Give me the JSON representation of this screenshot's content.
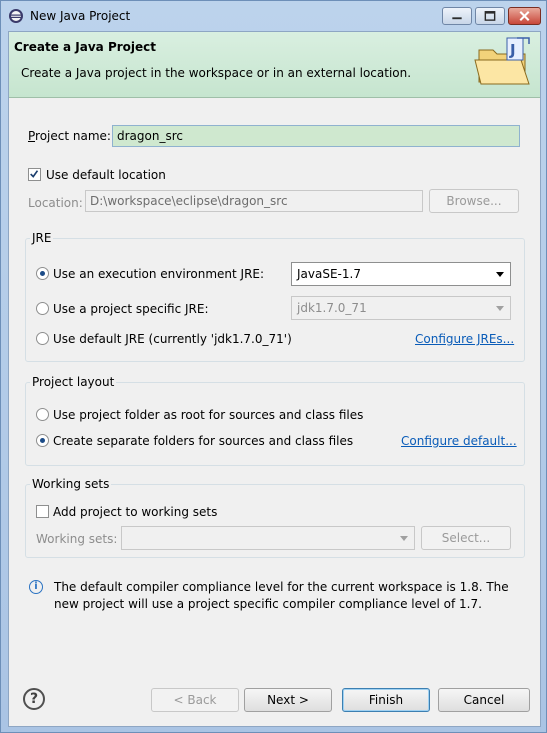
{
  "window": {
    "title": "New Java Project",
    "icon": "eclipse-icon"
  },
  "banner": {
    "title": "Create a Java Project",
    "description": "Create a Java project in the workspace or in an external location.",
    "image": "new-java-project-wizard-icon"
  },
  "project_name": {
    "label": "Project name:",
    "value": "dragon_src"
  },
  "default_location": {
    "label": "Use default location",
    "checked": true
  },
  "location": {
    "label": "Location:",
    "value": "D:\\workspace\\eclipse\\dragon_src",
    "browse_label": "Browse..."
  },
  "jre": {
    "group_title": "JRE",
    "options": [
      {
        "label": "Use an execution environment JRE:",
        "selected": true
      },
      {
        "label": "Use a project specific JRE:",
        "selected": false
      },
      {
        "label": "Use default JRE (currently 'jdk1.7.0_71')",
        "selected": false
      }
    ],
    "execution_env_value": "JavaSE-1.7",
    "project_specific_value": "jdk1.7.0_71",
    "configure_link": "Configure JREs..."
  },
  "layout": {
    "group_title": "Project layout",
    "options": [
      {
        "label": "Use project folder as root for sources and class files",
        "selected": false
      },
      {
        "label": "Create separate folders for sources and class files",
        "selected": true
      }
    ],
    "configure_link": "Configure default..."
  },
  "working_sets": {
    "group_title": "Working sets",
    "add_label": "Add project to working sets",
    "add_checked": false,
    "field_label": "Working sets:",
    "select_label": "Select..."
  },
  "info": {
    "text": "The default compiler compliance level for the current workspace is 1.8. The new project will use a project specific compiler compliance level of 1.7."
  },
  "buttons": {
    "back": "< Back",
    "next": "Next >",
    "finish": "Finish",
    "cancel": "Cancel"
  },
  "colors": {
    "banner_bg": "#c6e5cf",
    "link": "#0a5cb8",
    "highlight_field": "#cfe8cf"
  }
}
